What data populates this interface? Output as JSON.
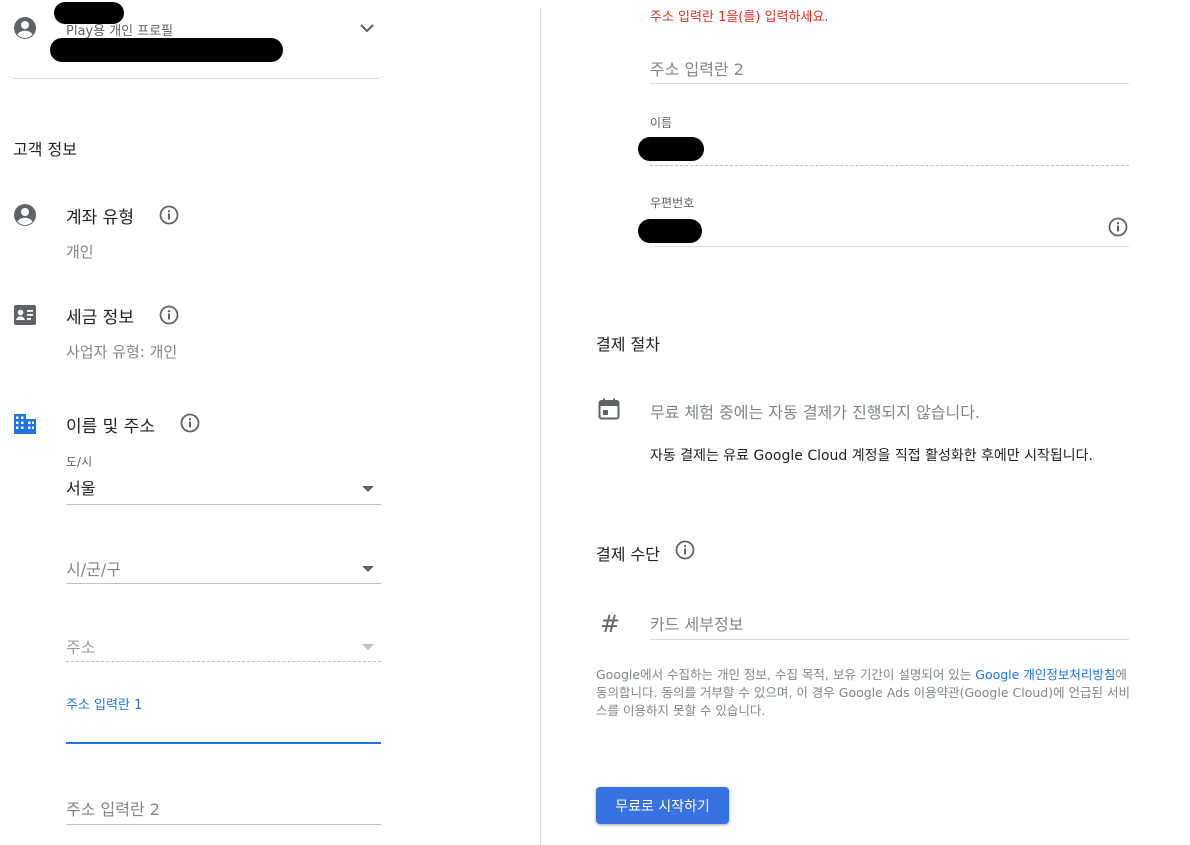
{
  "profile": {
    "subtitle": "Play용 개인 프로필"
  },
  "customer_info": {
    "title": "고객 정보",
    "account_type": {
      "label": "계좌 유형",
      "value": "개인"
    },
    "tax_info": {
      "label": "세금 정보",
      "value": "사업자 유형: 개인"
    },
    "name_address": {
      "label": "이름 및 주소",
      "province": {
        "label": "도/시",
        "value": "서울"
      },
      "city": {
        "placeholder": "시/군/구"
      },
      "address": {
        "placeholder": "주소"
      },
      "address_line1": {
        "label": "주소 입력란 1"
      },
      "address_line2_left": {
        "placeholder": "주소 입력란 2"
      }
    }
  },
  "right": {
    "error": "주소 입력란 1을(를) 입력하세요.",
    "address_line2": {
      "placeholder": "주소 입력란 2"
    },
    "name": {
      "label": "이름"
    },
    "postal": {
      "label": "우편번호"
    },
    "billing": {
      "title": "결제 절차",
      "trial_text": "무료 체험 중에는 자동 결제가 진행되지 않습니다.",
      "auto_text": "자동 결제는 유료 Google Cloud 계정을 직접 활성화한 후에만 시작됩니다."
    },
    "payment": {
      "title": "결제 수단",
      "card_placeholder": "카드 세부정보"
    },
    "consent": {
      "part1": "Google에서 수집하는 개인 정보, 수집 목적, 보유 기간이 설명되어 있는 ",
      "link": "Google 개인정보처리방침",
      "part2": "에 동의합니다. 동의를 거부할 수 있으며, 이 경우 Google Ads 이용약관(Google Cloud)에 언급된 서비스를 이용하지 못할 수 있습니다."
    },
    "start_button": "무료로 시작하기"
  },
  "colors": {
    "accent": "#1a73e8",
    "error": "#d93025",
    "button": "#3871e0"
  }
}
